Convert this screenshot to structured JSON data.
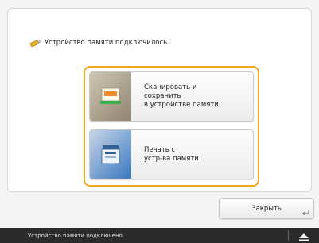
{
  "dialog": {
    "message": "Устройство памяти подключилось.",
    "options": [
      {
        "label": "Сканировать и\nсохранить\nв устройстве памяти",
        "icon": "scan-to-memory-icon"
      },
      {
        "label": "Печать с\nустр-ва памяти",
        "icon": "print-from-memory-icon"
      }
    ],
    "close_label": "Закрыть"
  },
  "status_bar": {
    "text": "Устройство памяти подключено.",
    "eject_icon": "eject-icon"
  },
  "colors": {
    "accent": "#f0a81c",
    "status_bg": "#2b2b2b"
  }
}
